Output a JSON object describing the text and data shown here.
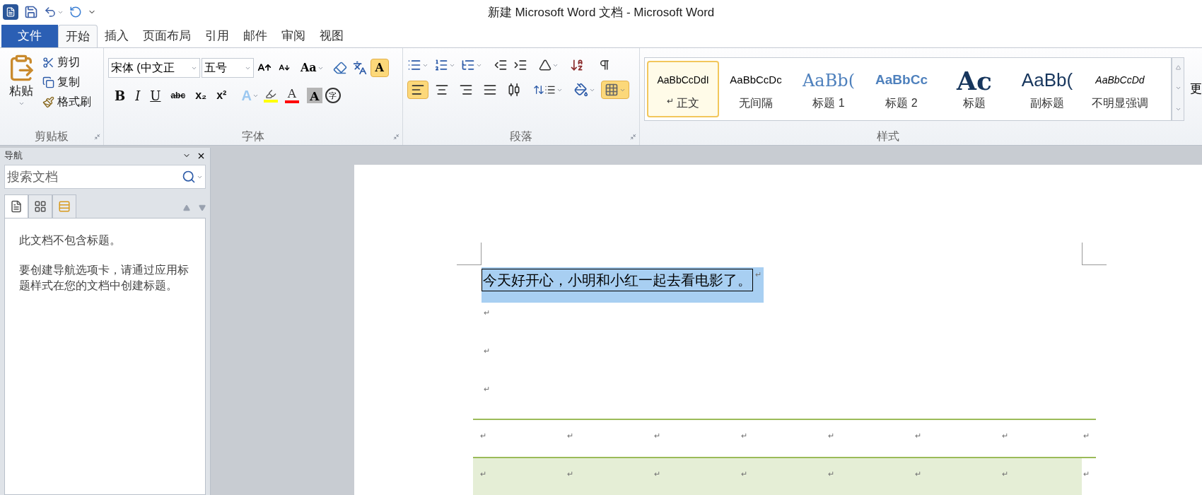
{
  "window": {
    "title": "新建 Microsoft Word 文档 - Microsoft Word"
  },
  "tabs": [
    {
      "label": "文件",
      "kind": "file",
      "selected": false
    },
    {
      "label": "开始",
      "kind": "tab",
      "selected": true
    },
    {
      "label": "插入",
      "kind": "tab",
      "selected": false
    },
    {
      "label": "页面布局",
      "kind": "tab",
      "selected": false
    },
    {
      "label": "引用",
      "kind": "tab",
      "selected": false
    },
    {
      "label": "邮件",
      "kind": "tab",
      "selected": false
    },
    {
      "label": "审阅",
      "kind": "tab",
      "selected": false
    },
    {
      "label": "视图",
      "kind": "tab",
      "selected": false
    }
  ],
  "clipboard": {
    "paste": "粘贴",
    "cut": "剪切",
    "copy": "复制",
    "format_painter": "格式刷",
    "label": "剪贴板"
  },
  "font": {
    "face": "宋体 (中文正",
    "size": "五号",
    "change_case": "Aa",
    "label": "字体",
    "char_border_on": true,
    "char_border_label": "A",
    "buttons": [
      {
        "kind": "bold",
        "label": "B"
      },
      {
        "kind": "italic",
        "label": "I"
      },
      {
        "kind": "underline",
        "label": "U"
      },
      {
        "kind": "strike",
        "label": "abc"
      },
      {
        "kind": "sub",
        "label": "x₂"
      },
      {
        "kind": "sup",
        "label": "x²"
      }
    ],
    "color_buttons": [
      {
        "kind": "effect",
        "label": "A"
      },
      {
        "kind": "highlight",
        "color": "#ffff00"
      },
      {
        "kind": "color",
        "label": "A",
        "color": "#ff0000"
      },
      {
        "kind": "shade",
        "label": "A"
      },
      {
        "kind": "enclose",
        "label": "字"
      }
    ]
  },
  "paragraph": {
    "label": "段落",
    "align": [
      {
        "selected": true
      },
      {
        "selected": false
      },
      {
        "selected": false
      },
      {
        "selected": false
      },
      {
        "selected": false
      }
    ],
    "borders_on": true
  },
  "styles": {
    "label": "样式",
    "more": "更",
    "items": [
      {
        "preview": "AaBbCcDdI",
        "name": "正文",
        "mark": "↵",
        "kind": "normal",
        "selected": true
      },
      {
        "preview": "AaBbCcDc",
        "name": "无间隔",
        "kind": "nospacing",
        "selected": false
      },
      {
        "preview": "AaBb(",
        "name": "标题 1",
        "kind": "heading1",
        "selected": false
      },
      {
        "preview": "AaBbCc",
        "name": "标题 2",
        "kind": "heading2",
        "selected": false
      },
      {
        "preview": "Ac",
        "name": "标题",
        "kind": "title",
        "selected": false
      },
      {
        "preview": "AaBb(",
        "name": "副标题",
        "kind": "subtitle",
        "selected": false
      },
      {
        "preview": "AaBbCcDd",
        "name": "不明显强调",
        "kind": "emphasis",
        "selected": false
      }
    ]
  },
  "navigation": {
    "title": "导航",
    "search": {
      "placeholder": "搜索文档"
    },
    "views": [
      {
        "kind": "headings",
        "selected": true
      },
      {
        "kind": "pages",
        "selected": false
      },
      {
        "kind": "results",
        "selected": false
      }
    ],
    "message": [
      "此文档不包含标题。",
      "要创建导航选项卡，请通过应用标题样式在您的文档中创建标题。"
    ]
  },
  "document": {
    "paragraphs": [
      {
        "text": "今天好开心，小明和小红一起去看电影了。",
        "mark": "↵",
        "selected": true
      },
      {
        "mark": "↵",
        "selected": false
      },
      {
        "mark": "↵",
        "selected": false
      },
      {
        "mark": "↵",
        "selected": false
      }
    ],
    "table": {
      "rows": [
        {
          "shaded": false,
          "cells": [
            "↵",
            "↵",
            "↵",
            "↵",
            "↵",
            "↵",
            "↵"
          ],
          "end": "↵"
        },
        {
          "shaded": true,
          "cells": [
            "↵",
            "↵",
            "↵",
            "↵",
            "↵",
            "↵",
            "↵"
          ],
          "end": "↵"
        }
      ]
    }
  }
}
